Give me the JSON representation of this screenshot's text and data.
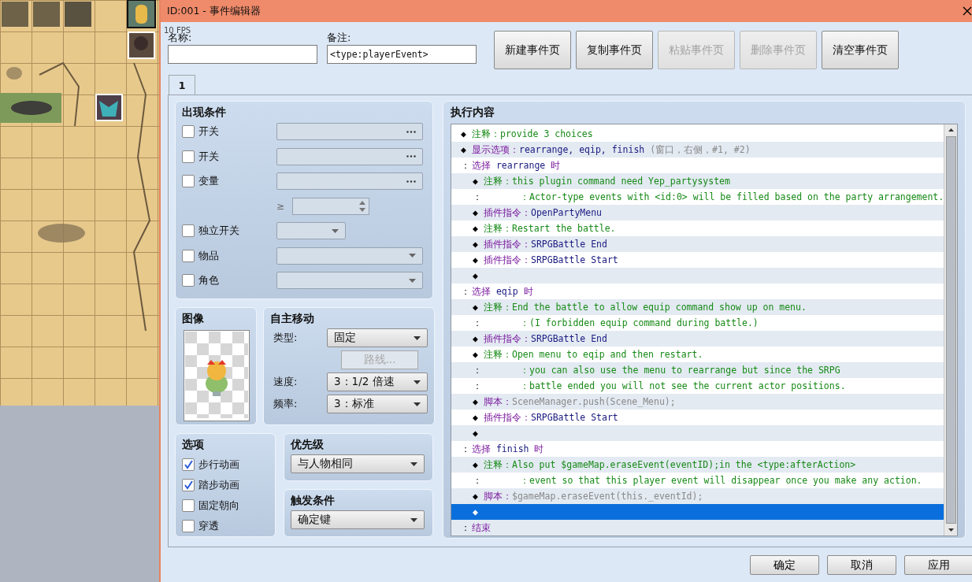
{
  "fps_overlay": "10 FPS",
  "window": {
    "title": "ID:001 - 事件编辑器"
  },
  "name": {
    "label": "名称:"
  },
  "note": {
    "label": "备注:",
    "value": "<type:playerEvent>"
  },
  "page_buttons": [
    {
      "label": "新建事件页",
      "disabled": false
    },
    {
      "label": "复制事件页",
      "disabled": false
    },
    {
      "label": "粘贴事件页",
      "disabled": true
    },
    {
      "label": "删除事件页",
      "disabled": true
    },
    {
      "label": "清空事件页",
      "disabled": false
    }
  ],
  "tabs": [
    {
      "label": "1",
      "selected": true
    }
  ],
  "conditions": {
    "title": "出现条件",
    "rows": [
      {
        "kind": "picker",
        "label": "开关",
        "checked": false
      },
      {
        "kind": "picker",
        "label": "开关",
        "checked": false
      },
      {
        "kind": "picker",
        "label": "变量",
        "checked": false
      },
      {
        "kind": "compare",
        "label": "≥"
      },
      {
        "kind": "short-dropdown",
        "label": "独立开关",
        "checked": false
      },
      {
        "kind": "dropdown",
        "label": "物品",
        "checked": false
      },
      {
        "kind": "dropdown",
        "label": "角色",
        "checked": false
      }
    ]
  },
  "image": {
    "title": "图像"
  },
  "movement": {
    "title": "自主移动",
    "type": {
      "label": "类型:",
      "value": "固定"
    },
    "route_button": {
      "label": "路线...",
      "disabled": true
    },
    "speed": {
      "label": "速度:",
      "value": "3：1/2 倍速"
    },
    "frequency": {
      "label": "频率:",
      "value": "3：标准"
    }
  },
  "options": {
    "title": "选项",
    "items": [
      {
        "label": "步行动画",
        "checked": true
      },
      {
        "label": "踏步动画",
        "checked": true
      },
      {
        "label": "固定朝向",
        "checked": false
      },
      {
        "label": "穿透",
        "checked": false
      }
    ]
  },
  "priority": {
    "title": "优先级",
    "value": "与人物相同"
  },
  "trigger": {
    "title": "触发条件",
    "value": "确定键"
  },
  "contents": {
    "title": "执行内容",
    "commands": [
      {
        "kind": "comment",
        "lead": "◆",
        "label": "注释：",
        "text": "provide 3 choices",
        "selected": false
      },
      {
        "kind": "choices",
        "lead": "◆",
        "label": "显示选项：",
        "text": "rearrange, eqip, finish",
        "suffix": "(窗口，右侧，#1, #2)",
        "selected": false
      },
      {
        "kind": "branch",
        "lead": "：",
        "label": "选择",
        "text": "rearrange",
        "tail": "时",
        "selected": false,
        "children": [
          {
            "kind": "comment",
            "lead": "◆",
            "label": "注释：",
            "text": "this plugin command need Yep_partysystem",
            "selected": false
          },
          {
            "kind": "continuation",
            "lead": "：",
            "text": "：Actor-type events with <id:0> will be filled based on the party arrangement.",
            "selected": false
          },
          {
            "kind": "plugin",
            "lead": "◆",
            "label": "插件指令：",
            "text": "OpenPartyMenu",
            "selected": false
          },
          {
            "kind": "comment",
            "lead": "◆",
            "label": "注释：",
            "text": "Restart the battle.",
            "selected": false
          },
          {
            "kind": "plugin",
            "lead": "◆",
            "label": "插件指令：",
            "text": "SRPGBattle End",
            "selected": false
          },
          {
            "kind": "plugin",
            "lead": "◆",
            "label": "插件指令：",
            "text": "SRPGBattle Start",
            "selected": false
          },
          {
            "kind": "empty",
            "lead": "◆",
            "selected": false
          }
        ]
      },
      {
        "kind": "branch",
        "lead": "：",
        "label": "选择",
        "text": "eqip",
        "tail": "时",
        "selected": false,
        "children": [
          {
            "kind": "comment",
            "lead": "◆",
            "label": "注释：",
            "text": "End the battle to allow equip command show up on menu.",
            "selected": false
          },
          {
            "kind": "continuation",
            "lead": "：",
            "text": "：(I forbidden equip command during battle.)",
            "selected": false
          },
          {
            "kind": "plugin",
            "lead": "◆",
            "label": "插件指令：",
            "text": "SRPGBattle End",
            "selected": false
          },
          {
            "kind": "comment",
            "lead": "◆",
            "label": "注释：",
            "text": "Open menu to eqip and then restart.",
            "selected": false
          },
          {
            "kind": "continuation",
            "lead": "：",
            "text": "：you can also use the menu to rearrange but since the SRPG",
            "selected": false
          },
          {
            "kind": "continuation",
            "lead": "：",
            "text": "：battle ended you will not see the current actor positions.",
            "selected": false
          },
          {
            "kind": "script",
            "lead": "◆",
            "label": "脚本：",
            "text": "SceneManager.push(Scene_Menu);",
            "selected": false
          },
          {
            "kind": "plugin",
            "lead": "◆",
            "label": "插件指令：",
            "text": "SRPGBattle Start",
            "selected": false
          },
          {
            "kind": "empty",
            "lead": "◆",
            "selected": false
          }
        ]
      },
      {
        "kind": "branch",
        "lead": "：",
        "label": "选择",
        "text": "finish",
        "tail": "时",
        "selected": false,
        "children": [
          {
            "kind": "comment",
            "lead": "◆",
            "label": "注释：",
            "text": "Also put $gameMap.eraseEvent(eventID);in the <type:afterAction>",
            "selected": false
          },
          {
            "kind": "continuation",
            "lead": "：",
            "text": "：event so that this player event will disappear once you make any action.",
            "selected": false
          },
          {
            "kind": "script",
            "lead": "◆",
            "label": "脚本：",
            "text": "$gameMap.eraseEvent(this._eventId);",
            "selected": false
          },
          {
            "kind": "empty",
            "lead": "◆",
            "selected": true
          }
        ]
      },
      {
        "kind": "end",
        "lead": "：",
        "label": "结束",
        "selected": false
      }
    ]
  },
  "dialog_buttons": [
    "确定",
    "取消",
    "应用"
  ]
}
